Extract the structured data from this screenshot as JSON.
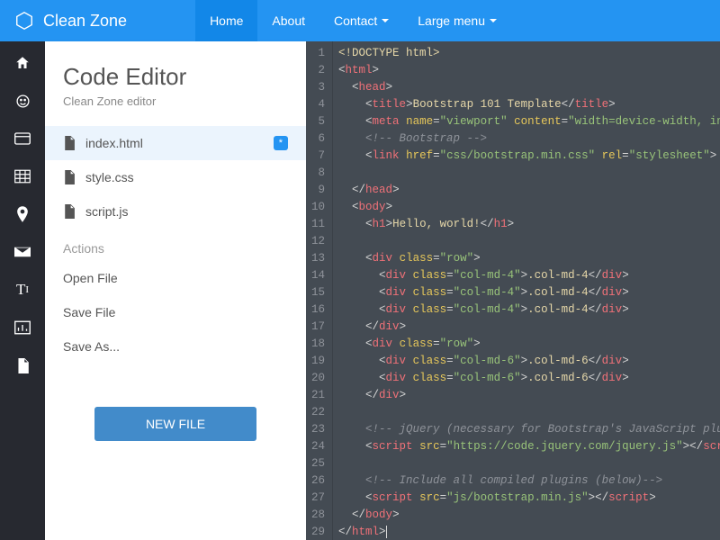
{
  "brand": "Clean Zone",
  "nav": {
    "home": "Home",
    "about": "About",
    "contact": "Contact",
    "large": "Large menu"
  },
  "side": {
    "title": "Code Editor",
    "subtitle": "Clean Zone editor",
    "files": [
      {
        "name": "index.html",
        "active": true,
        "modified": "*"
      },
      {
        "name": "style.css",
        "active": false
      },
      {
        "name": "script.js",
        "active": false
      }
    ],
    "actions_header": "Actions",
    "actions": {
      "open": "Open File",
      "save": "Save File",
      "saveas": "Save As..."
    },
    "newfile": "NEW FILE"
  },
  "colors": {
    "primary": "#2494f2",
    "sidebar": "#272930",
    "editor_bg": "#444b53"
  },
  "code_lines": 29,
  "code": {
    "l1": "<!DOCTYPE html>",
    "l5_title": "Bootstrap 101 Template",
    "l6_meta": "width=device-width, initia",
    "l7_cmt": "<!-- Bootstrap -->",
    "l8_href": "css/bootstrap.min.css",
    "l8_rel": "stylesheet",
    "l11_txt": "Hello, world!",
    "row_class": "row",
    "col4": "col-md-4",
    "col6": "col-md-6",
    "l23_cmt": "<!-- jQuery (necessary for Bootstrap's JavaScript plugins",
    "l24_src": "https://code.jquery.com/jquery.js",
    "l26_cmt": "<!-- Include all compiled plugins (below)-->",
    "l27_src": "js/bootstrap.min.js"
  }
}
